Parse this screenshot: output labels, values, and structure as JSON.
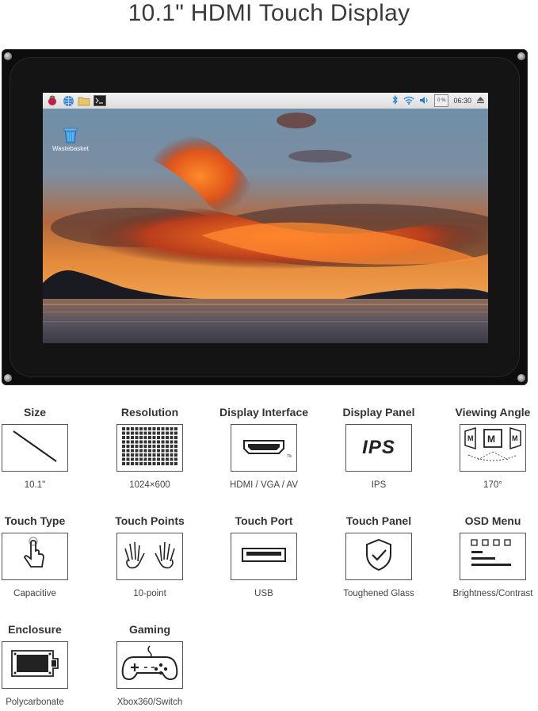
{
  "title": "10.1\" HDMI Touch Display",
  "screen": {
    "taskbar": {
      "time": "06:30",
      "cpu": "0 %",
      "icons": [
        "raspberry-icon",
        "globe-icon",
        "folder-icon",
        "terminal-icon"
      ],
      "tray_icons": [
        "bluetooth-icon",
        "wifi-icon",
        "volume-icon",
        "eject-icon"
      ]
    },
    "desktop_icon_label": "Wastebasket"
  },
  "features": [
    {
      "label": "Size",
      "value": "10.1\"",
      "icon": "diagonal-line-icon"
    },
    {
      "label": "Resolution",
      "value": "1024×600",
      "icon": "pixel-grid-icon"
    },
    {
      "label": "Display Interface",
      "value": "HDMI / VGA / AV",
      "icon": "hdmi-port-icon"
    },
    {
      "label": "Display Panel",
      "value": "IPS",
      "icon": "ips-text-icon",
      "icon_text": "IPS"
    },
    {
      "label": "Viewing Angle",
      "value": "170°",
      "icon": "viewing-angle-icon"
    },
    {
      "label": "Touch Type",
      "value": "Capacitive",
      "icon": "finger-touch-icon"
    },
    {
      "label": "Touch Points",
      "value": "10-point",
      "icon": "two-hands-icon"
    },
    {
      "label": "Touch Port",
      "value": "USB",
      "icon": "usb-port-icon"
    },
    {
      "label": "Touch Panel",
      "value": "Toughened Glass",
      "icon": "shield-check-icon"
    },
    {
      "label": "OSD Menu",
      "value": "Brightness/Contrast",
      "icon": "osd-menu-icon"
    },
    {
      "label": "Enclosure",
      "value": "Polycarbonate",
      "icon": "enclosure-board-icon"
    },
    {
      "label": "Gaming",
      "value": "Xbox360/Switch",
      "icon": "gamepad-icon"
    }
  ],
  "colors": {
    "bezel": "#0d0d0d",
    "accent_tray": "#1a7fd6"
  }
}
